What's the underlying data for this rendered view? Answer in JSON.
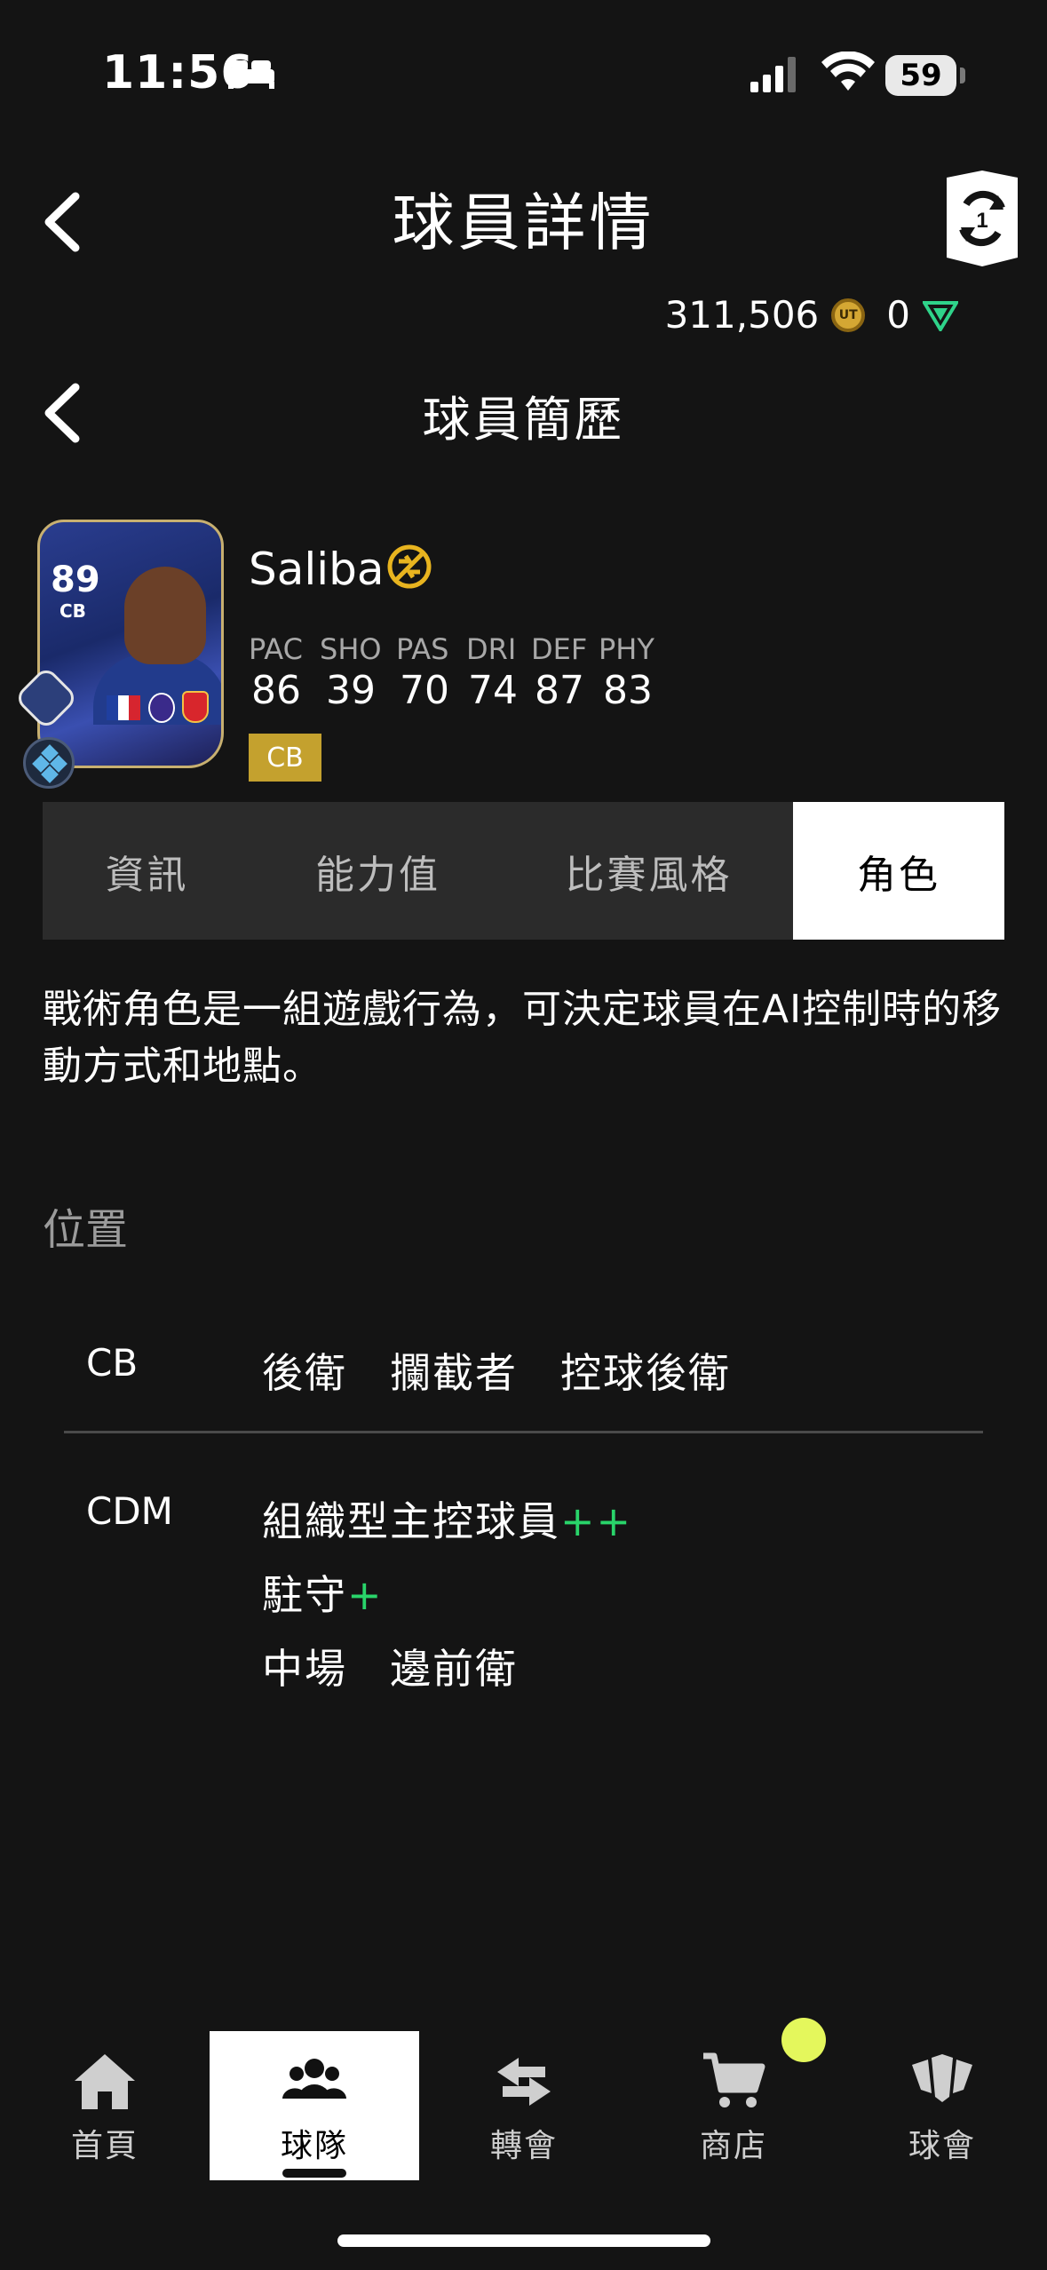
{
  "status_bar": {
    "time": "11:56",
    "battery": "59"
  },
  "header": {
    "title": "球員詳情",
    "subtitle": "球員簡歷"
  },
  "wallet": {
    "coins": "311,506",
    "points": "0"
  },
  "player": {
    "name": "Saliba",
    "rating": "89",
    "card_position": "CB",
    "position_chip": "CB",
    "stats": [
      {
        "label": "PAC",
        "value": "86"
      },
      {
        "label": "SHO",
        "value": "39"
      },
      {
        "label": "PAS",
        "value": "70"
      },
      {
        "label": "DRI",
        "value": "74"
      },
      {
        "label": "DEF",
        "value": "87"
      },
      {
        "label": "PHY",
        "value": "83"
      }
    ]
  },
  "tabs": [
    {
      "label": "資訊"
    },
    {
      "label": "能力值"
    },
    {
      "label": "比賽風格"
    },
    {
      "label": "角色",
      "active": true
    }
  ],
  "roles_section": {
    "description": "戰術角色是一組遊戲行為，可決定球員在AI控制時的移動方式和地點。",
    "position_heading": "位置",
    "cb": {
      "code": "CB",
      "line1": "後衛　攔截者　控球後衛"
    },
    "cdm": {
      "code": "CDM",
      "line1": "組織型主控球員",
      "line1_plus": "++",
      "line2": "駐守",
      "line2_plus": "+",
      "line3": "中場　邊前衛"
    }
  },
  "bottom_nav": [
    {
      "label": "首頁",
      "icon": "home-icon"
    },
    {
      "label": "球隊",
      "icon": "team-icon",
      "active": true
    },
    {
      "label": "轉會",
      "icon": "transfer-icon"
    },
    {
      "label": "商店",
      "icon": "cart-icon"
    },
    {
      "label": "球會",
      "icon": "club-icon"
    }
  ],
  "colors": {
    "background": "#141414",
    "plus": "#29d46a",
    "chip": "#c4a12e",
    "notification": "#e4f75c"
  }
}
